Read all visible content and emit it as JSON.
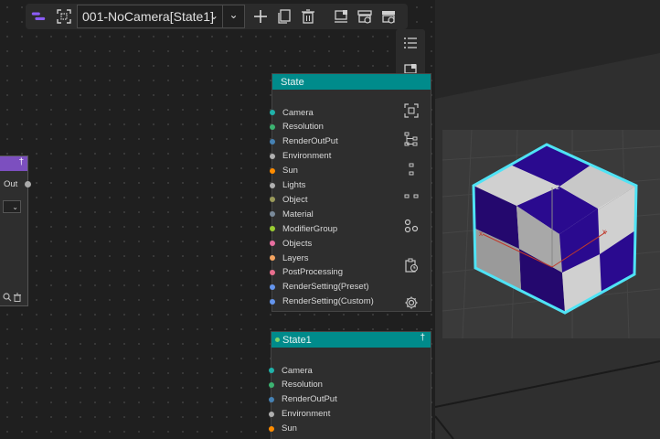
{
  "toolbar": {
    "scene_name": "001-NoCamera[State1]",
    "buttons": [
      {
        "name": "app-logo-icon"
      },
      {
        "name": "frame-select-icon"
      },
      {
        "name": "add-icon"
      },
      {
        "name": "copy-icon"
      },
      {
        "name": "delete-icon"
      },
      {
        "name": "render-icon"
      },
      {
        "name": "render-queue-icon"
      },
      {
        "name": "batch-render-icon"
      }
    ]
  },
  "side_tools": [
    {
      "name": "list-icon"
    },
    {
      "name": "render-preview-icon"
    }
  ],
  "state_node": {
    "title": "State",
    "ports": [
      {
        "label": "Camera",
        "color": "#20b2aa"
      },
      {
        "label": "Resolution",
        "color": "#3cb371"
      },
      {
        "label": "RenderOutPut",
        "color": "#4682b4"
      },
      {
        "label": "Environment",
        "color": "#b0b0b0"
      },
      {
        "label": "Sun",
        "color": "#ff8c00"
      },
      {
        "label": "Lights",
        "color": "#b0b0b0"
      },
      {
        "label": "Object",
        "color": "#9a9a5a"
      },
      {
        "label": "Material",
        "color": "#7a8a9a"
      },
      {
        "label": "ModifierGroup",
        "color": "#9acd32"
      },
      {
        "label": "Objects",
        "color": "#e86fa0"
      },
      {
        "label": "Layers",
        "color": "#f4a460"
      },
      {
        "label": "PostProcessing",
        "color": "#e96f8f"
      },
      {
        "label": "RenderSetting(Preset)",
        "color": "#6495ed"
      },
      {
        "label": "RenderSetting(Custom)",
        "color": "#6495ed"
      }
    ],
    "icons": [
      "frame-icon",
      "hierarchy-icon",
      "split-vertical-icon",
      "split-horizontal-icon",
      "nodes-icon",
      "clipboard-clock-icon",
      "gear-icon"
    ]
  },
  "state1_node": {
    "title": "State1",
    "ports": [
      {
        "label": "Camera",
        "color": "#20b2aa"
      },
      {
        "label": "Resolution",
        "color": "#3cb371"
      },
      {
        "label": "RenderOutPut",
        "color": "#4682b4"
      },
      {
        "label": "Environment",
        "color": "#b0b0b0"
      },
      {
        "label": "Sun",
        "color": "#ff8c00"
      }
    ]
  },
  "purple_node": {
    "out_label": "Out"
  }
}
